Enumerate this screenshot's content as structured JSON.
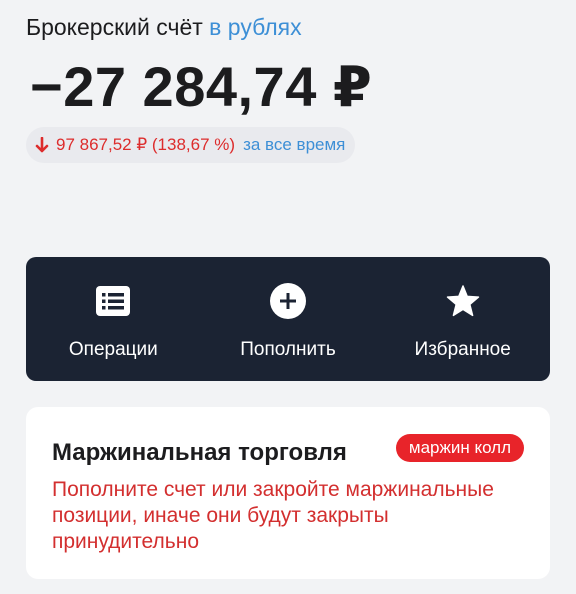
{
  "account": {
    "title": "Брокерский счёт",
    "currency_link": "в рублях",
    "balance": "−27 284,74 ₽"
  },
  "change": {
    "direction": "down",
    "value": "97 867,52 ₽ (138,67 %)",
    "period": "за все время",
    "color": "#dd2c2c"
  },
  "actions": [
    {
      "icon": "list-icon",
      "label": "Операции"
    },
    {
      "icon": "plus-circle-icon",
      "label": "Пополнить"
    },
    {
      "icon": "star-icon",
      "label": "Избранное"
    }
  ],
  "margin_card": {
    "title": "Маржинальная торговля",
    "badge": "маржин колл",
    "warning": "Пополните счет или закройте маржинальные позиции, иначе они будут закрыты принудительно"
  },
  "colors": {
    "background": "#f2f3f5",
    "panel": "#1b2333",
    "accent_blue": "#3d8fd6",
    "danger": "#e8242a"
  }
}
